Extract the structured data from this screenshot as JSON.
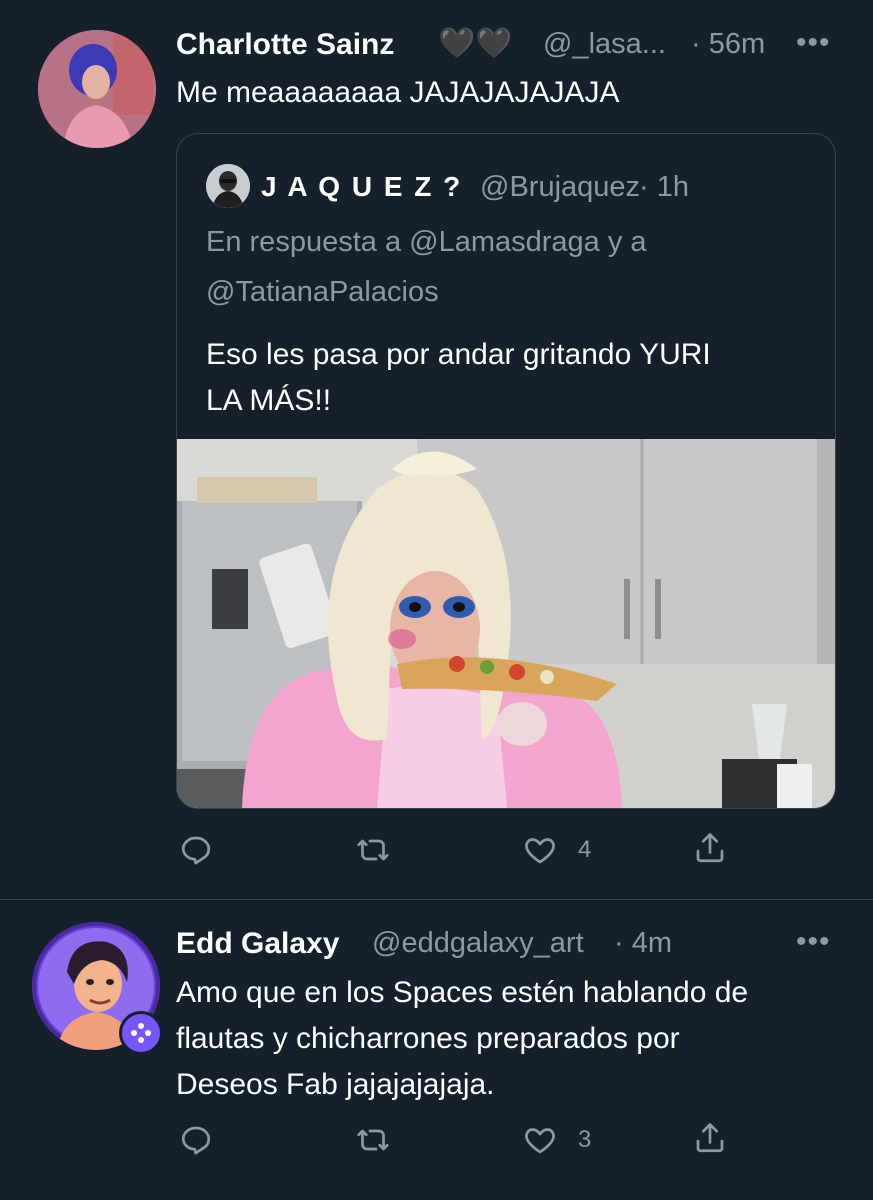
{
  "tweet1": {
    "author_name": "Charlotte Sainz",
    "author_emoji": "🖤🖤",
    "handle": "@_lasa...",
    "time": "· 56m",
    "more": "•••",
    "text": "Me meaaaaaaaa JAJAJAJAJAJA",
    "quote": {
      "author_name": "J A Q U E Z ?",
      "handle": "@Brujaquez",
      "time": "· 1h",
      "reply_line1": "En respuesta a @Lamasdraga y a",
      "reply_line2": "@TatianaPalacios",
      "text_line1": "Eso les pasa por andar gritando YURI",
      "text_line2": "LA MÁS!!",
      "media_description": "drag performer eating a tostada in a kitchen"
    },
    "actions": {
      "reply_count": "",
      "retweet_count": "",
      "like_count": "4",
      "share_count": ""
    }
  },
  "tweet2": {
    "author_name": "Edd Galaxy",
    "handle": "@eddgalaxy_art",
    "time": "· 4m",
    "more": "•••",
    "text_line1": "Amo que en los Spaces estén hablando de",
    "text_line2": "flautas y chicharrones preparados por",
    "text_line3": "Deseos Fab jajajajajaja.",
    "actions": {
      "reply_count": "",
      "retweet_count": "",
      "like_count": "3",
      "share_count": ""
    }
  },
  "colors": {
    "background": "#15202b",
    "secondary_text": "#8b98a5",
    "border": "#38444d",
    "badge": "#7856ff"
  },
  "icons": [
    "reply-icon",
    "retweet-icon",
    "like-icon",
    "share-icon",
    "more-icon",
    "gamepad-badge-icon"
  ]
}
